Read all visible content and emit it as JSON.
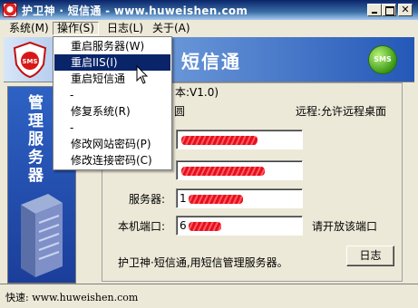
{
  "window": {
    "title": "护卫神 · 短信通 - www.huweishen.com",
    "minimize_icon": "minimize-icon",
    "maximize_icon": "maximize-icon",
    "close_icon": "close-icon"
  },
  "menubar": {
    "items": [
      {
        "label": "系统(M)"
      },
      {
        "label": "操作(S)"
      },
      {
        "label": "日志(L)"
      },
      {
        "label": "关于(A)"
      }
    ],
    "active_index": 1
  },
  "dropdown": {
    "items": [
      {
        "label": "重启服务器(W)"
      },
      {
        "label": "重启IIS(I)"
      },
      {
        "label": "重启短信通"
      },
      {
        "label": "-"
      },
      {
        "label": "修复系统(R)"
      },
      {
        "label": "-"
      },
      {
        "label": "修改网站密码(P)"
      },
      {
        "label": "修改连接密码(C)"
      }
    ],
    "selected_index": 1
  },
  "banner": {
    "title": "短信通",
    "sms_badge": "SMS",
    "logo_text": "SMS"
  },
  "sidebar": {
    "title": "管理服务器"
  },
  "group": {
    "legend": "本:V1.0)"
  },
  "form": {
    "row1_suffix": "圆",
    "remote_label": "远程:允许远程桌面",
    "server_label": "服务器:",
    "server_value": "1",
    "port_label": "本机端口:",
    "port_value": "6",
    "port_note": "请开放该端口"
  },
  "description": "护卫神·短信通,用短信管理服务器。",
  "log_button": "日志",
  "status": {
    "text": "快速: www.huweishen.com"
  },
  "colors": {
    "title_bar": "#0a246a",
    "menu_highlight": "#0a246a",
    "sidebar": "#2d62c4",
    "redaction": "#e6101a"
  }
}
